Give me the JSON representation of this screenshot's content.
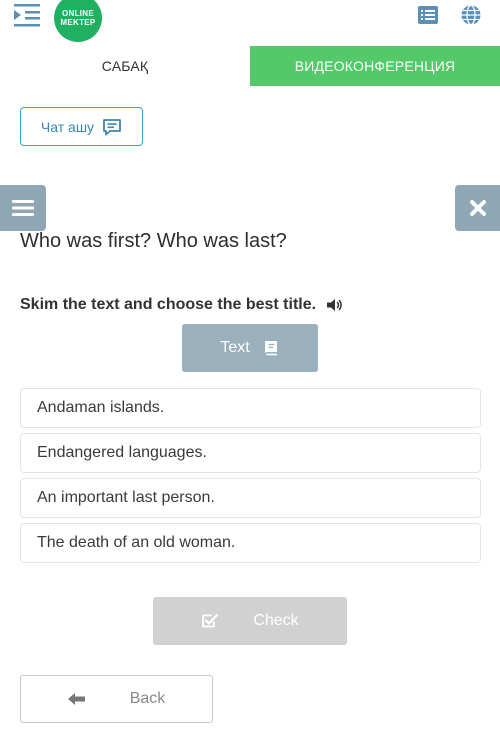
{
  "header": {
    "logo_line1": "ONLINE",
    "logo_line2": "MEKTEP"
  },
  "tabs": [
    {
      "label": "САБАҚ"
    },
    {
      "label": "ВИДЕОКОНФЕРЕНЦИЯ"
    }
  ],
  "chat": {
    "label": "Чат ашу"
  },
  "question": {
    "title": "Who was first? Who was last?",
    "instruction": "Skim the text and choose the best title.",
    "text_button": "Text"
  },
  "options": [
    {
      "label": "Andaman islands."
    },
    {
      "label": "Endangered languages."
    },
    {
      "label": "An important last person."
    },
    {
      "label": "The death of an old woman."
    }
  ],
  "actions": {
    "check": "Check",
    "back": "Back"
  },
  "colors": {
    "brand_green": "#1fb061",
    "video_tab": "#54c96a",
    "side_buttons": "#8fa6b4",
    "text_button": "#9bb0bd",
    "check_disabled": "#d1d1d1",
    "chat_border": "#3aa4c8"
  },
  "icons": [
    "menu-indent-icon",
    "list-icon",
    "globe-icon",
    "chat-bubble-icon",
    "hamburger-icon",
    "close-icon",
    "speaker-icon",
    "book-icon",
    "checkbox-icon",
    "arrow-left-icon"
  ]
}
